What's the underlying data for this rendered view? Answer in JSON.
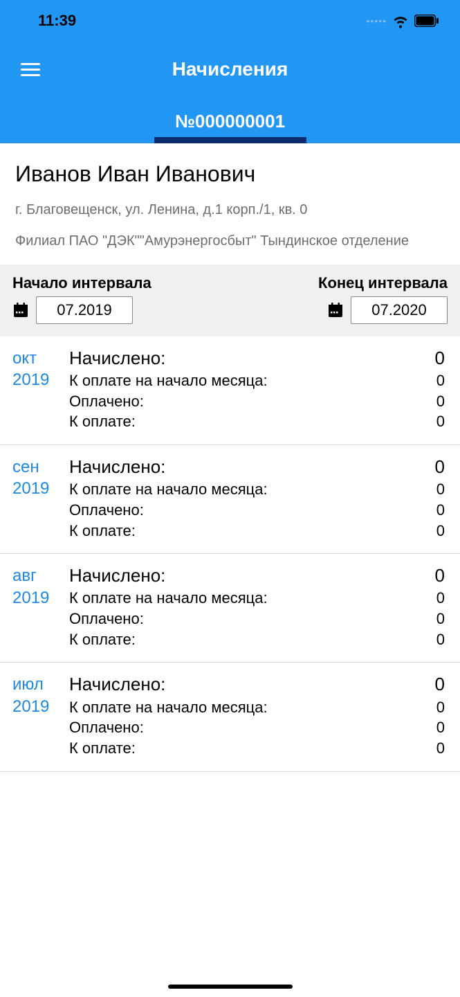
{
  "status": {
    "time": "11:39"
  },
  "header": {
    "title": "Начисления"
  },
  "account": {
    "number": "№000000001"
  },
  "customer": {
    "name": "Иванов Иван Иванович",
    "address": "г. Благовещенск, ул. Ленина, д.1 корп./1, кв. 0",
    "branch": "Филиал ПАО \"ДЭК\"\"Амурэнергосбыт\" Тындинское отделение"
  },
  "interval": {
    "start_label": "Начало интервала",
    "end_label": "Конец интервала",
    "start_value": "07.2019",
    "end_value": "07.2020"
  },
  "labels": {
    "accrued": "Начислено:",
    "due_start": "К оплате на начало месяца:",
    "paid": "Оплачено:",
    "due": "К оплате:"
  },
  "rows": [
    {
      "month": "окт",
      "year": "2019",
      "accrued": "0",
      "due_start": "0",
      "paid": "0",
      "due": "0"
    },
    {
      "month": "сен",
      "year": "2019",
      "accrued": "0",
      "due_start": "0",
      "paid": "0",
      "due": "0"
    },
    {
      "month": "авг",
      "year": "2019",
      "accrued": "0",
      "due_start": "0",
      "paid": "0",
      "due": "0"
    },
    {
      "month": "июл",
      "year": "2019",
      "accrued": "0",
      "due_start": "0",
      "paid": "0",
      "due": "0"
    }
  ]
}
